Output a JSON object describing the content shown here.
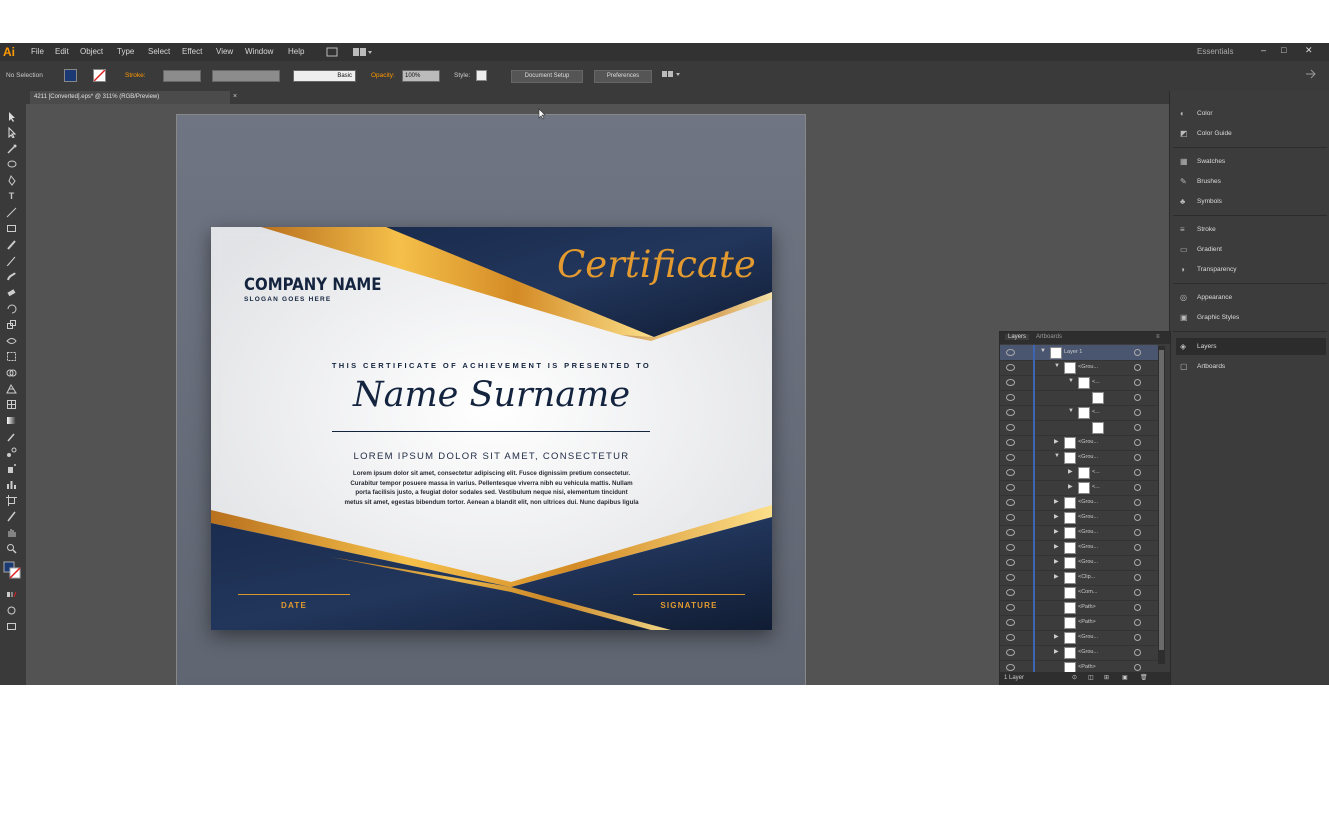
{
  "app": {
    "logo": "Ai",
    "menus": [
      "File",
      "Edit",
      "Object",
      "Type",
      "Select",
      "Effect",
      "View",
      "Window",
      "Help"
    ],
    "workspace": "Essentials",
    "window_controls": [
      "–",
      "□",
      "✕"
    ]
  },
  "control_bar": {
    "selection": "No Selection",
    "stroke_label": "Stroke:",
    "brush": "Basic",
    "opacity_label": "Opacity:",
    "opacity_value": "100%",
    "style_label": "Style:",
    "document_setup": "Document Setup",
    "preferences": "Preferences",
    "accent_color": "#ff9a00"
  },
  "document_tab": {
    "title": "4211 [Converted].eps* @ 311% (RGB/Preview)",
    "close": "×"
  },
  "certificate": {
    "company_name": "COMPANY NAME",
    "slogan": "SLOGAN GOES HERE",
    "title": "Certificate",
    "presented": "THIS CERTIFICATE OF ACHIEVEMENT IS PRESENTED TO",
    "name": "Name Surname",
    "lorem": "LOREM IPSUM DOLOR SIT AMET, CONSECTETUR",
    "paragraph": [
      "Lorem ipsum dolor sit amet, consectetur adipiscing elit. Fusce dignissim pretium consectetur.",
      "Curabitur tempor posuere massa in varius. Pellentesque viverra nibh eu vehicula mattis. Nullam",
      "porta facilisis justo, a feugiat dolor sodales sed. Vestibulum neque nisi, elementum tincidunt",
      "metus sit amet, egestas bibendum tortor. Aenean a blandit elit, non ultrices dui. Nunc dapibus ligula"
    ],
    "date_label": "DATE",
    "signature_label": "SIGNATURE",
    "navy": "#14243f",
    "gold": "#e39a2f"
  },
  "right_panel": {
    "groups": [
      [
        "Color",
        "Color Guide"
      ],
      [
        "Swatches",
        "Brushes",
        "Symbols"
      ],
      [
        "Stroke",
        "Gradient",
        "Transparency"
      ],
      [
        "Appearance",
        "Graphic Styles"
      ],
      [
        "Layers",
        "Artboards"
      ]
    ]
  },
  "layers_panel": {
    "tabs": [
      "Layers",
      "Artboards"
    ],
    "rows": [
      {
        "name": "Layer 1",
        "indent": 0,
        "expanded": true
      },
      {
        "name": "<Grou...",
        "indent": 1,
        "expanded": true
      },
      {
        "name": "<...",
        "indent": 2,
        "expanded": true
      },
      {
        "name": "",
        "indent": 3,
        "expanded": null
      },
      {
        "name": "<...",
        "indent": 2,
        "expanded": true
      },
      {
        "name": "",
        "indent": 3,
        "expanded": null
      },
      {
        "name": "<Grou...",
        "indent": 1,
        "expanded": false
      },
      {
        "name": "<Grou...",
        "indent": 1,
        "expanded": true
      },
      {
        "name": "<...",
        "indent": 2,
        "expanded": false
      },
      {
        "name": "<...",
        "indent": 2,
        "expanded": false
      },
      {
        "name": "<Grou...",
        "indent": 1,
        "expanded": false
      },
      {
        "name": "<Grou...",
        "indent": 1,
        "expanded": false
      },
      {
        "name": "<Grou...",
        "indent": 1,
        "expanded": false
      },
      {
        "name": "<Grou...",
        "indent": 1,
        "expanded": false
      },
      {
        "name": "<Grou...",
        "indent": 1,
        "expanded": false
      },
      {
        "name": "<Clip...",
        "indent": 1,
        "expanded": false
      },
      {
        "name": "<Com...",
        "indent": 1,
        "expanded": null
      },
      {
        "name": "<Path>",
        "indent": 1,
        "expanded": null
      },
      {
        "name": "<Path>",
        "indent": 1,
        "expanded": null
      },
      {
        "name": "<Grou...",
        "indent": 1,
        "expanded": false
      },
      {
        "name": "<Grou...",
        "indent": 1,
        "expanded": false
      },
      {
        "name": "<Path>",
        "indent": 1,
        "expanded": null
      }
    ],
    "footer": "1 Layer"
  }
}
